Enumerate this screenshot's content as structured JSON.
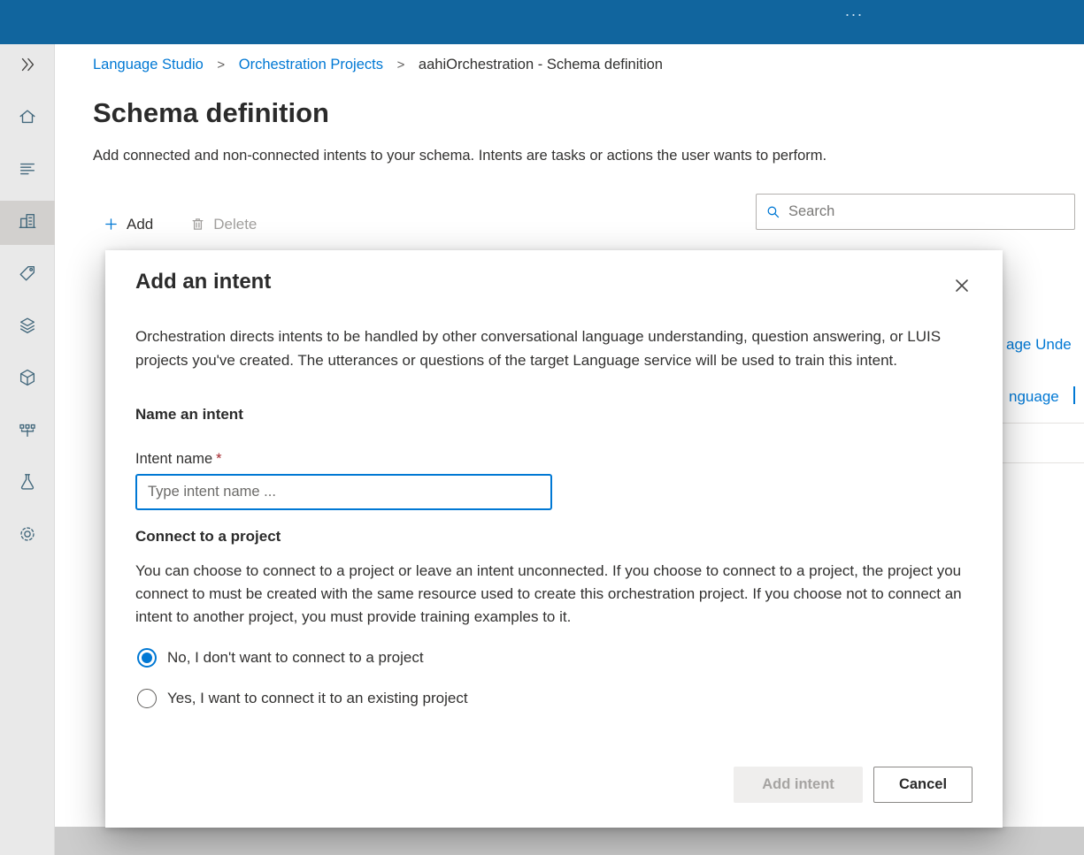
{
  "colors": {
    "topbar": "#11659e",
    "accent": "#0078d4",
    "required_asterisk": "#a4262c",
    "text": "#323130",
    "disabled_text": "#a19f9d"
  },
  "topbar": {
    "overflow": "..."
  },
  "sidebar": {
    "items": [
      {
        "icon": "double-chevron-right-icon",
        "selected": false
      },
      {
        "icon": "home-icon",
        "selected": false
      },
      {
        "icon": "document-lines-icon",
        "selected": false
      },
      {
        "icon": "buildings-icon",
        "selected": true
      },
      {
        "icon": "tag-icon",
        "selected": false
      },
      {
        "icon": "layers-icon",
        "selected": false
      },
      {
        "icon": "cube-icon",
        "selected": false
      },
      {
        "icon": "deploy-icon",
        "selected": false
      },
      {
        "icon": "flask-icon",
        "selected": false
      },
      {
        "icon": "gear-icon",
        "selected": false
      }
    ]
  },
  "breadcrumb": {
    "separator": ">",
    "items": [
      {
        "label": "Language Studio",
        "link": true
      },
      {
        "label": "Orchestration Projects",
        "link": true
      },
      {
        "label": "aahiOrchestration - Schema definition",
        "link": false
      }
    ]
  },
  "page": {
    "title": "Schema definition",
    "subtitle": "Add connected and non-connected intents to your schema. Intents are tasks or actions the user wants to perform."
  },
  "toolbar": {
    "add_label": "Add",
    "delete_label": "Delete"
  },
  "search": {
    "placeholder": "Search"
  },
  "background_table": {
    "clipped_link_1": "age Unde",
    "clipped_link_2": "nguage"
  },
  "modal": {
    "title": "Add an intent",
    "description": "Orchestration directs intents to be handled by other conversational language understanding, question answering, or LUIS projects you've created. The utterances or questions of the target Language service will be used to train this intent.",
    "name_section": {
      "header": "Name an intent",
      "label": "Intent name",
      "required": "*",
      "placeholder": "Type intent name ..."
    },
    "connect_section": {
      "header": "Connect to a project",
      "description": "You can choose to connect to a project or leave an intent unconnected. If you choose to connect to a project, the project you connect to must be created with the same resource used to create this orchestration project. If you choose not to connect an intent to another project, you must provide training examples to it.",
      "options": [
        {
          "label": "No, I don't want to connect to a project",
          "selected": true
        },
        {
          "label": "Yes, I want to connect it to an existing project",
          "selected": false
        }
      ]
    },
    "actions": {
      "add": "Add intent",
      "cancel": "Cancel"
    }
  }
}
